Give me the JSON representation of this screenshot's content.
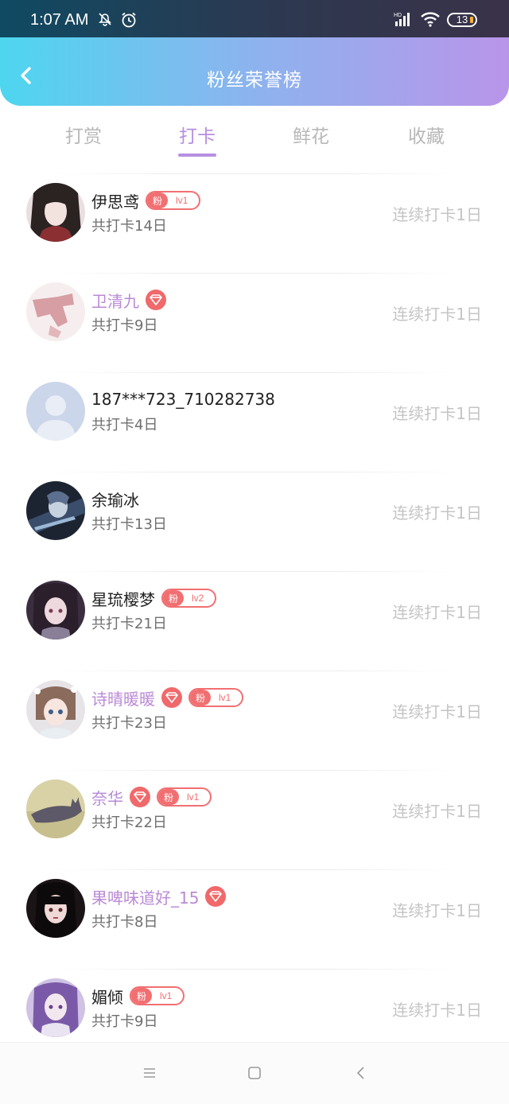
{
  "status_bar": {
    "time": "1:07 AM",
    "network_badge": "HD",
    "battery": "13",
    "icons": [
      "bell-muted-icon",
      "alarm-icon",
      "signal-icon",
      "wifi-icon",
      "battery-icon"
    ]
  },
  "header": {
    "title": "粉丝荣誉榜",
    "back_icon": "chevron-left-icon",
    "gradient": [
      "#4dd6ef",
      "#b995ea"
    ]
  },
  "tabs": [
    {
      "label": "打赏",
      "active": false
    },
    {
      "label": "打卡",
      "active": true
    },
    {
      "label": "鲜花",
      "active": false
    },
    {
      "label": "收藏",
      "active": false
    }
  ],
  "colors": {
    "accent": "#b68fe0",
    "vip_name": "#b98ad6",
    "badge": "#f16f71",
    "streak_text": "#c4c4c4"
  },
  "list": [
    {
      "name": "伊思鸢",
      "vip": false,
      "diamond": false,
      "fan_badge": {
        "label": "粉",
        "level": "lv1"
      },
      "days": "共打卡14日",
      "streak": "连续打卡1日"
    },
    {
      "name": "卫清九",
      "vip": true,
      "diamond": true,
      "fan_badge": null,
      "days": "共打卡9日",
      "streak": "连续打卡1日"
    },
    {
      "name": "187***723_710282738",
      "vip": false,
      "diamond": false,
      "fan_badge": null,
      "days": "共打卡4日",
      "streak": "连续打卡1日"
    },
    {
      "name": "余瑜冰",
      "vip": false,
      "diamond": false,
      "fan_badge": null,
      "days": "共打卡13日",
      "streak": "连续打卡1日"
    },
    {
      "name": "星琉樱梦",
      "vip": false,
      "diamond": false,
      "fan_badge": {
        "label": "粉",
        "level": "lv2"
      },
      "days": "共打卡21日",
      "streak": "连续打卡1日"
    },
    {
      "name": "诗晴暖暖",
      "vip": true,
      "diamond": true,
      "fan_badge": {
        "label": "粉",
        "level": "lv1"
      },
      "days": "共打卡23日",
      "streak": "连续打卡1日"
    },
    {
      "name": "奈华",
      "vip": true,
      "diamond": true,
      "fan_badge": {
        "label": "粉",
        "level": "lv1"
      },
      "days": "共打卡22日",
      "streak": "连续打卡1日"
    },
    {
      "name": "果啤味道好_15",
      "vip": true,
      "diamond": true,
      "fan_badge": null,
      "days": "共打卡8日",
      "streak": "连续打卡1日"
    },
    {
      "name": "媚倾",
      "vip": false,
      "diamond": false,
      "fan_badge": {
        "label": "粉",
        "level": "lv1"
      },
      "days": "共打卡9日",
      "streak": "连续打卡1日"
    }
  ],
  "nav_bar": {
    "icons": [
      "menu-icon",
      "home-icon",
      "back-icon"
    ]
  }
}
